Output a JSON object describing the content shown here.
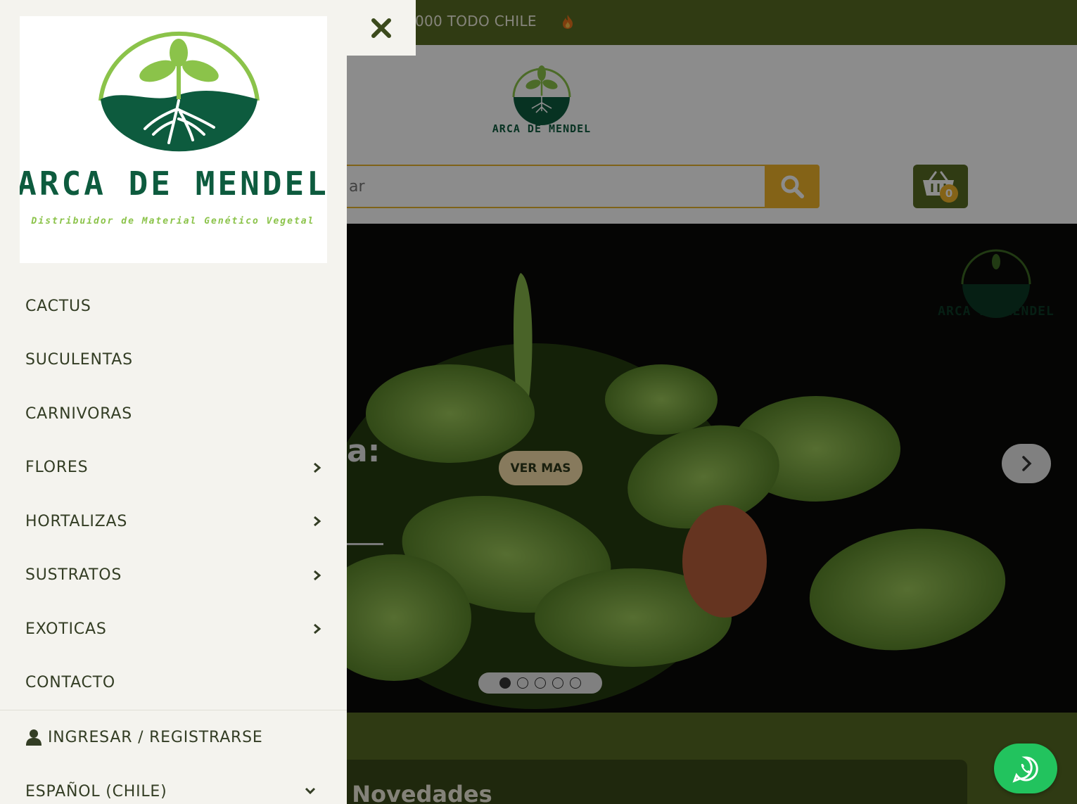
{
  "topbar": {
    "text": "000 TODO CHILE"
  },
  "brand": {
    "name": "ARCA DE MENDEL",
    "tagline": "Distribuidor de Material Genético Vegetal"
  },
  "search": {
    "placeholder": "ar"
  },
  "cart": {
    "count": "0"
  },
  "hero": {
    "button_label": "VER MAS",
    "partial_text": "a:",
    "slides": 5,
    "active_slide": 1
  },
  "section": {
    "title": "s Novedades"
  },
  "drawer": {
    "menu": [
      {
        "label": "CACTUS",
        "has_submenu": false
      },
      {
        "label": "SUCULENTAS",
        "has_submenu": false
      },
      {
        "label": "CARNIVORAS",
        "has_submenu": false
      },
      {
        "label": "FLORES",
        "has_submenu": true
      },
      {
        "label": "HORTALIZAS",
        "has_submenu": true
      },
      {
        "label": "SUSTRATOS",
        "has_submenu": true
      },
      {
        "label": "EXOTICAS",
        "has_submenu": true
      },
      {
        "label": "CONTACTO",
        "has_submenu": false
      }
    ],
    "login_label": "INGRESAR / REGISTRARSE",
    "language_label": "ESPAÑOL (CHILE)"
  },
  "colors": {
    "brand_green": "#586c24",
    "logo_dark_green": "#0d5b3e",
    "logo_light_green": "#8bc34a",
    "accent_yellow": "#f0b52b",
    "whatsapp_green": "#22c35e"
  },
  "icons": {
    "close": "close-icon",
    "search": "search-icon",
    "cart": "basket-icon",
    "next": "chevron-right-icon",
    "user": "user-icon",
    "whatsapp": "whatsapp-icon"
  }
}
